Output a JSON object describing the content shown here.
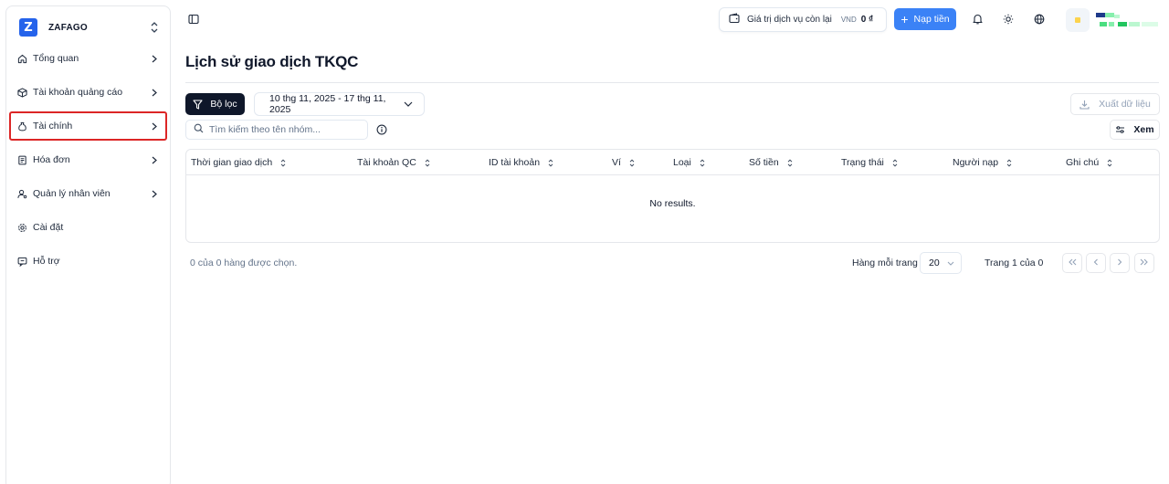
{
  "brand": {
    "logo_letter": "Z",
    "name": "ZAFAGO"
  },
  "sidebar": {
    "items": [
      {
        "label": "Tổng quan",
        "icon": "home-icon",
        "has_chevron": true
      },
      {
        "label": "Tài khoản quảng cáo",
        "icon": "box-icon",
        "has_chevron": true
      },
      {
        "label": "Tài chính",
        "icon": "money-bag-icon",
        "has_chevron": true,
        "highlighted": true
      },
      {
        "label": "Hóa đơn",
        "icon": "receipt-icon",
        "has_chevron": true
      },
      {
        "label": "Quản lý nhân viên",
        "icon": "user-cog-icon",
        "has_chevron": true
      },
      {
        "label": "Cài đặt",
        "icon": "gear-icon",
        "has_chevron": false
      },
      {
        "label": "Hỗ trợ",
        "icon": "chat-support-icon",
        "has_chevron": false
      }
    ]
  },
  "topbar": {
    "balance_label": "Giá trị dịch vụ còn lại",
    "balance_currency": "VND",
    "balance_amount": "0 ₫",
    "deposit_label": "Nạp tiền"
  },
  "main": {
    "title": "Lịch sử giao dịch TKQC",
    "filter_label": "Bộ lọc",
    "date_range": "10 thg 11, 2025 - 17 thg 11, 2025",
    "export_label": "Xuất dữ liệu",
    "search_placeholder": "Tìm kiếm theo tên nhóm...",
    "view_label": "Xem"
  },
  "table": {
    "columns": [
      "Thời gian giao dịch",
      "Tài khoản QC",
      "ID tài khoản",
      "Ví",
      "Loại",
      "Số tiền",
      "Trạng thái",
      "Người nạp",
      "Ghi chú"
    ],
    "empty_text": "No results."
  },
  "footer": {
    "selected_text": "0 của 0 hàng được chọn.",
    "rows_per_page_label": "Hàng mỗi trang",
    "rows_per_page_value": "20",
    "page_info": "Trang 1 của 0"
  },
  "colors": {
    "primary": "#3b82f6",
    "dark": "#0f172a",
    "highlight": "#dc2626",
    "brand": "#2563eb"
  }
}
